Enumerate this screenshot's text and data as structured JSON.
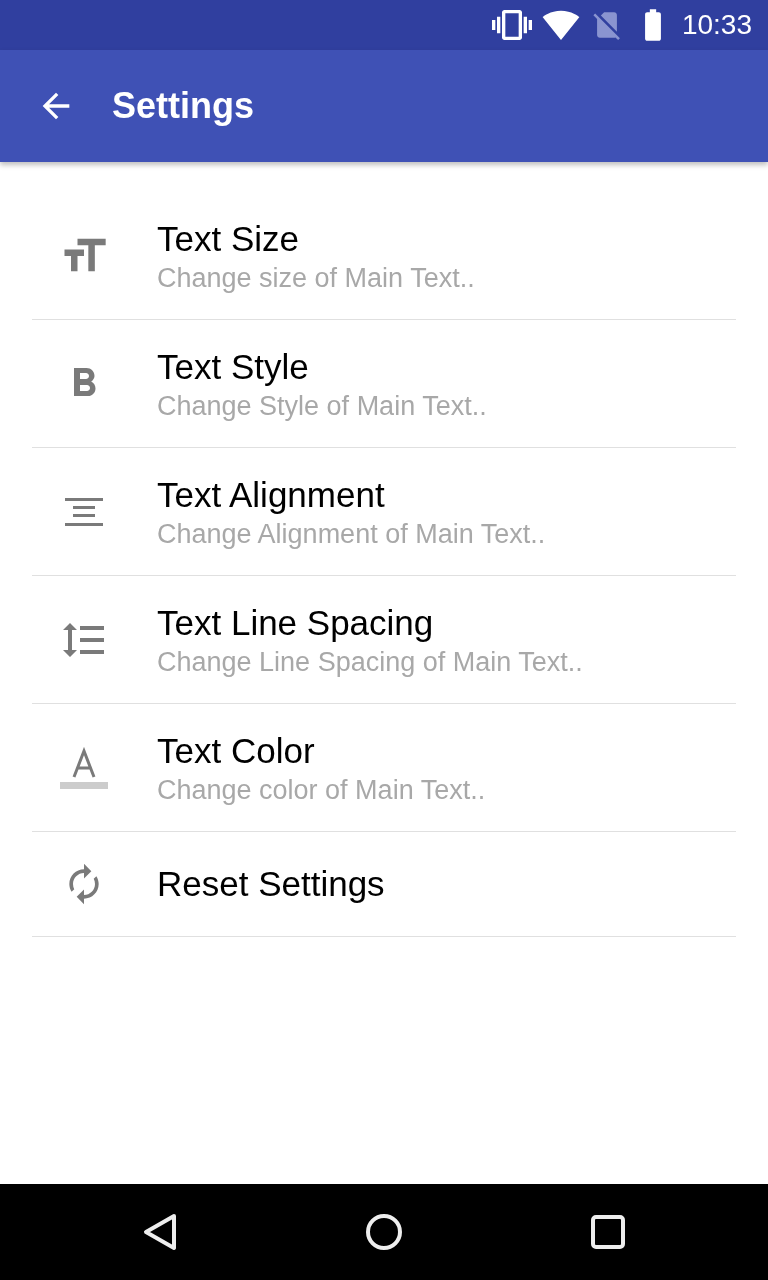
{
  "status_bar": {
    "time": "10:33"
  },
  "app_bar": {
    "title": "Settings"
  },
  "settings": [
    {
      "kind": "size",
      "title": "Text Size",
      "subtitle": "Change size of Main Text.."
    },
    {
      "kind": "style",
      "title": "Text Style",
      "subtitle": "Change Style of Main Text.."
    },
    {
      "kind": "alignment",
      "title": "Text Alignment",
      "subtitle": "Change Alignment of Main Text.."
    },
    {
      "kind": "spacing",
      "title": "Text Line Spacing",
      "subtitle": "Change Line Spacing of Main Text.."
    },
    {
      "kind": "color",
      "title": "Text Color",
      "subtitle": "Change color of Main Text.."
    },
    {
      "kind": "reset",
      "title": "Reset Settings"
    }
  ]
}
